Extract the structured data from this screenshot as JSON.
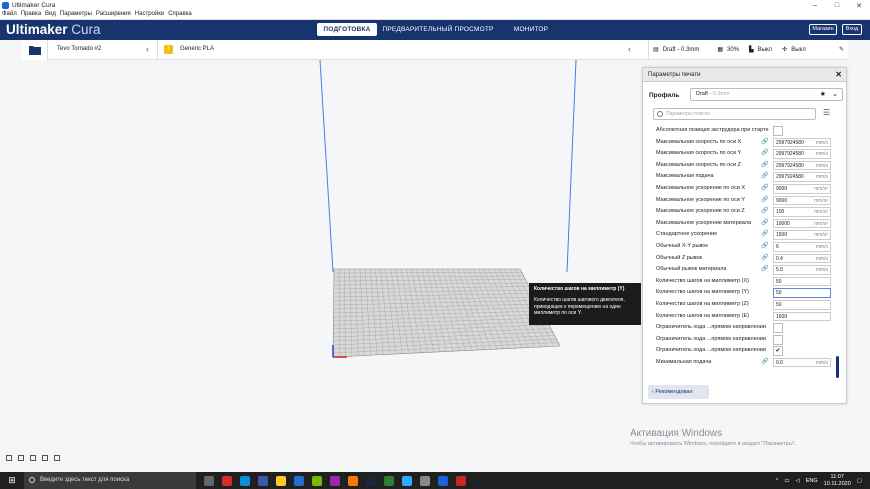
{
  "window": {
    "title": "Ultimaker Cura"
  },
  "menu": [
    "Файл",
    "Правка",
    "Вид",
    "Параметры",
    "Расширения",
    "Настройки",
    "Справка"
  ],
  "header": {
    "logo_bold": "Ultimaker",
    "logo_light": "Cura",
    "stages": [
      {
        "label": "ПОДГОТОВКА",
        "active": true
      },
      {
        "label": "ПРЕДВАРИТЕЛЬНЫЙ ПРОСМОТР",
        "active": false
      },
      {
        "label": "МОНИТОР",
        "active": false
      }
    ],
    "marketplace": "Магазин",
    "account": "Вход"
  },
  "stagebar": {
    "printer": "Tevo Tornado #2",
    "material": "Generic PLA"
  },
  "printbar": {
    "profile": "Draft - 0.3mm",
    "infill": "30%",
    "support": "Выкл",
    "adhesion": "Выкл"
  },
  "panel": {
    "title": "Параметры печати",
    "profile_label": "Профиль",
    "profile_value": "Draft",
    "profile_hint": "- 0.3mm",
    "search_placeholder": "Параметры поиска",
    "recommended_button": "Рекомендован",
    "rows": [
      {
        "label": "Абсолютная позиция экструдера при старте",
        "type": "check",
        "checked": false,
        "link": false
      },
      {
        "label": "Максимальная скорость по оси X",
        "value": "2997924580",
        "unit": "mm/s",
        "link": true
      },
      {
        "label": "Максимальная скорость по оси Y",
        "value": "2997924580",
        "unit": "mm/s",
        "link": true
      },
      {
        "label": "Максимальная скорость по оси Z",
        "value": "2997924580",
        "unit": "mm/s",
        "link": true
      },
      {
        "label": "Максимальная подача",
        "value": "2997924580",
        "unit": "mm/s",
        "link": true
      },
      {
        "label": "Максимальное ускорение по оси X",
        "value": "9000",
        "unit": "mm/s²",
        "link": true
      },
      {
        "label": "Максимальное ускорение по оси Y",
        "value": "9000",
        "unit": "mm/s²",
        "link": true
      },
      {
        "label": "Максимальное ускорение по оси Z",
        "value": "100",
        "unit": "mm/s²",
        "link": true
      },
      {
        "label": "Максимальное ускорение материала",
        "value": "10000",
        "unit": "mm/s²",
        "link": true
      },
      {
        "label": "Стандартное ускорение",
        "value": "1500",
        "unit": "mm/s²",
        "link": true
      },
      {
        "label": "Обычный X-Y рывок",
        "value": "6",
        "unit": "mm/s",
        "link": true
      },
      {
        "label": "Обычный Z рывок",
        "value": "0.4",
        "unit": "mm/s",
        "link": true
      },
      {
        "label": "Обычный рывок материала",
        "value": "5.0",
        "unit": "mm/s",
        "link": true
      },
      {
        "label": "Количество шагов на миллиметр (X)",
        "value": "50",
        "unit": "",
        "link": false
      },
      {
        "label": "Количество шагов на миллиметр (Y)",
        "value": "50",
        "unit": "",
        "link": false,
        "highlight": true
      },
      {
        "label": "Количество шагов на миллиметр (Z)",
        "value": "50",
        "unit": "",
        "link": false
      },
      {
        "label": "Количество шагов на миллиметр (E)",
        "value": "1600",
        "unit": "",
        "link": false
      },
      {
        "label": "Ограничитель хода ...прямом направлении",
        "type": "check",
        "checked": false,
        "link": false
      },
      {
        "label": "Ограничитель хода ...прямом направлении",
        "type": "check",
        "checked": false,
        "link": false
      },
      {
        "label": "Ограничитель хода ...прямом направлении",
        "type": "check",
        "checked": true,
        "link": false
      },
      {
        "label": "Минимальная подача",
        "value": "0.0",
        "unit": "mm/s",
        "link": true
      }
    ]
  },
  "tooltip": {
    "title": "Количество шагов на миллиметр (Y)",
    "body": "Количество шагов шагового двигателя, приводящее к перемещению на один миллиметр по оси Y."
  },
  "watermark": {
    "title": "Активация Windows",
    "subtitle": "Чтобы активировать Windows, перейдите в раздел \"Параметры\"."
  },
  "taskbar": {
    "search_placeholder": "Введите здесь текст для поиска",
    "language": "ENG",
    "time": "11:07",
    "date": "10.11.2020"
  },
  "colors": {
    "header": "#18346f",
    "accent": "#5b86e0",
    "material": "#f1bd0a"
  }
}
